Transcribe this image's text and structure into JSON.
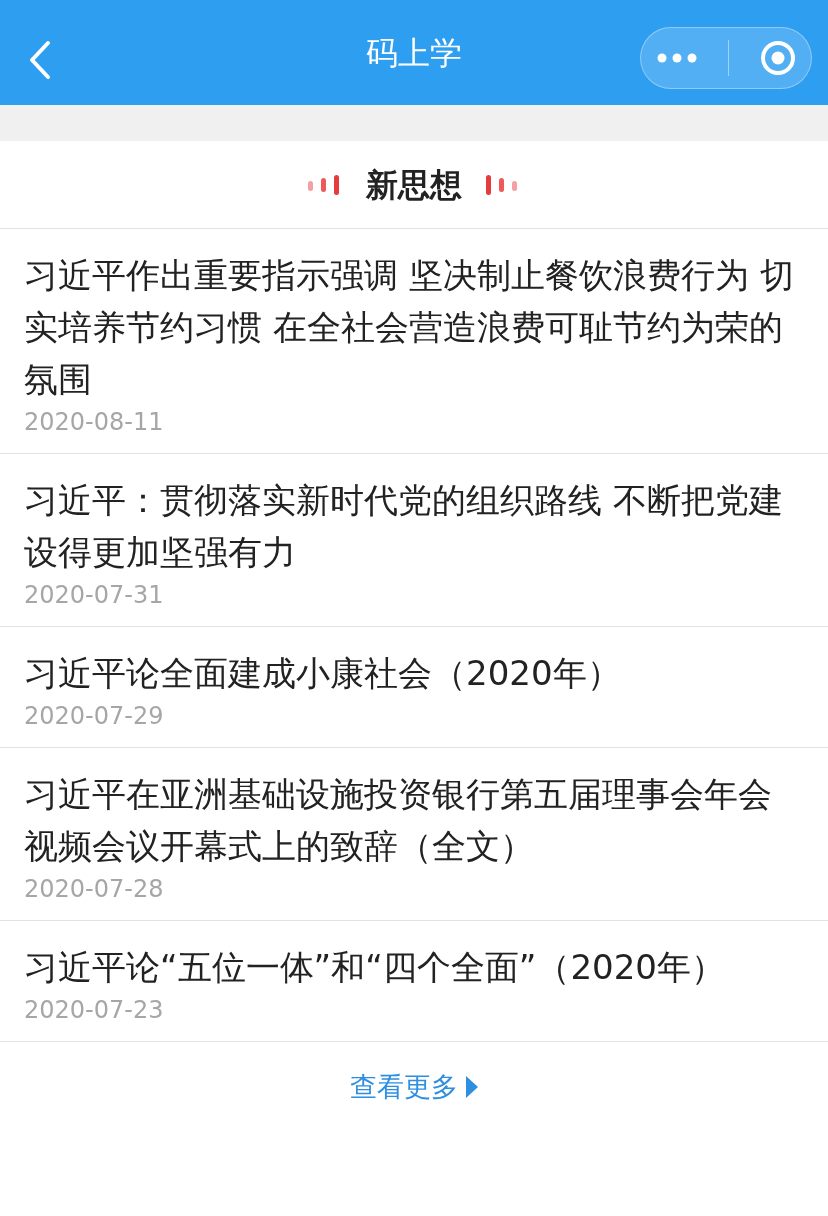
{
  "header": {
    "title": "码上学"
  },
  "section": {
    "title": "新思想"
  },
  "articles": [
    {
      "title": "习近平作出重要指示强调 坚决制止餐饮浪费行为 切实培养节约习惯 在全社会营造浪费可耻节约为荣的氛围",
      "date": "2020-08-11"
    },
    {
      "title": "习近平：贯彻落实新时代党的组织路线 不断把党建设得更加坚强有力",
      "date": "2020-07-31"
    },
    {
      "title": "习近平论全面建成小康社会（2020年）",
      "date": "2020-07-29"
    },
    {
      "title": "习近平在亚洲基础设施投资银行第五届理事会年会视频会议开幕式上的致辞（全文）",
      "date": "2020-07-28"
    },
    {
      "title": "习近平论“五位一体”和“四个全面”（2020年）",
      "date": "2020-07-23"
    }
  ],
  "more_link": "查看更多"
}
